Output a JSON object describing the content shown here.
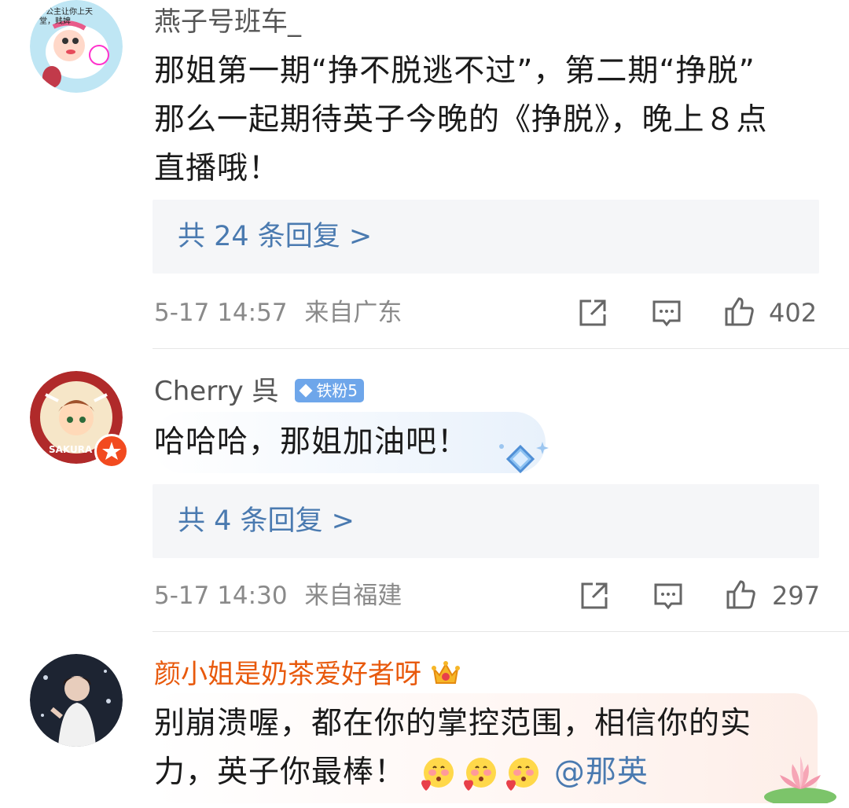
{
  "comments": [
    {
      "username": "燕子号班车_",
      "avatar_caption": "公主让你上天堂，贱婢",
      "text_lines": [
        "那姐第一期“挣不脱逃不过”，第二期“挣脱”",
        "那么一起期待英子今晚的《挣脱》，晚上８点",
        "直播哦！"
      ],
      "replies_label": "共 24 条回复 >",
      "time": "5-17 14:57",
      "location": "来自广东",
      "likes": "402"
    },
    {
      "username": "Cherry 呉",
      "badge": "铁粉5",
      "avatar_caption": "SAKURA",
      "text_lines": [
        "哈哈哈，那姐加油吧！"
      ],
      "replies_label": "共 4 条回复 >",
      "time": "5-17 14:30",
      "location": "来自福建",
      "likes": "297"
    },
    {
      "username": "颜小姐是奶茶爱好者呀",
      "text_lines": [
        "别崩溃喔，都在你的掌控范围，相信你的实",
        "力，英子你最棒！"
      ],
      "mention": "@那英"
    }
  ],
  "icons": {
    "share": "share-icon",
    "comment": "comment-icon",
    "like": "thumbs-up-icon",
    "crown": "crown-icon",
    "emoji": "blush-emoji-icon"
  },
  "colors": {
    "link": "#4a7ab0",
    "vip_name": "#e8590c",
    "meta": "#8a8a8a",
    "reply_bg": "#f5f6f8",
    "badge": "#6ea6ea"
  }
}
